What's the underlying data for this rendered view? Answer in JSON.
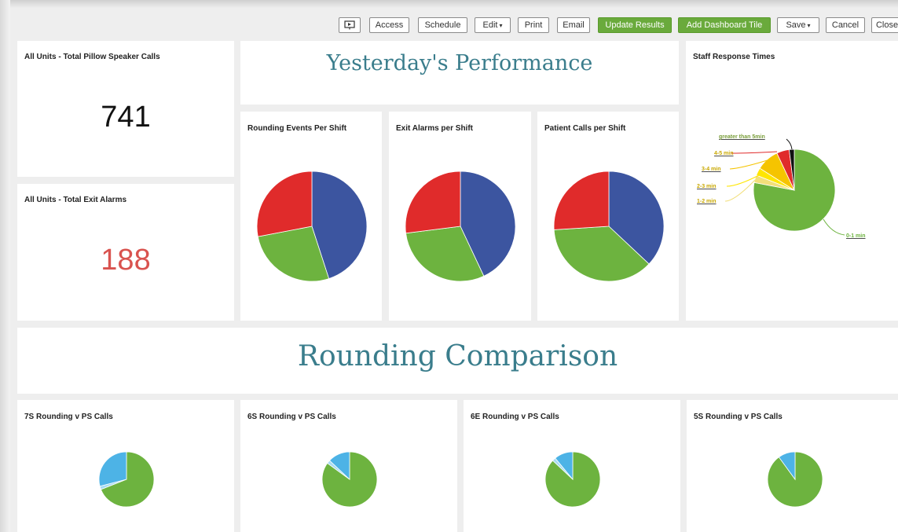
{
  "toolbar": {
    "present_icon": "present-icon",
    "access": "Access",
    "schedule": "Schedule",
    "edit": "Edit",
    "print": "Print",
    "email": "Email",
    "update_results": "Update Results",
    "add_tile": "Add Dashboard Tile",
    "save": "Save",
    "cancel": "Cancel",
    "close": "Close",
    "caret": "▾"
  },
  "colors": {
    "accent_green": "#6aaa3c",
    "heading_teal": "#3a7d8c",
    "pie_blue": "#3c55a0",
    "pie_green": "#6db33f",
    "pie_red": "#e02b2b",
    "pie_light_blue": "#4db3e6",
    "pie_yellow": "#f5c400",
    "big_red": "#d9534f"
  },
  "kpis": {
    "pillow_title": "All Units - Total Pillow Speaker Calls",
    "pillow_value": "741",
    "exit_title": "All Units - Total Exit Alarms",
    "exit_value": "188"
  },
  "headings": {
    "yesterday": "Yesterday's Performance",
    "rounding": "Rounding Comparison"
  },
  "shift_charts": {
    "rounding_title": "Rounding Events Per Shift",
    "exit_title": "Exit Alarms per Shift",
    "patient_title": "Patient Calls per Shift"
  },
  "staff": {
    "title": "Staff Response Times",
    "labels": [
      "0-1 min",
      "1-2 min",
      "2-3 min",
      "3-4 min",
      "4-5 min",
      "greater than 5min"
    ]
  },
  "units": {
    "u7s": "7S Rounding v PS Calls",
    "u6s": "6S Rounding v PS Calls",
    "u6e": "6E Rounding v PS Calls",
    "u5s": "5S Rounding v PS Calls"
  },
  "chart_data": [
    {
      "type": "pie",
      "values": [
        45,
        27,
        28
      ],
      "colors": [
        "#3c55a0",
        "#6db33f",
        "#e02b2b"
      ]
    },
    {
      "type": "pie",
      "values": [
        43,
        30,
        27
      ],
      "colors": [
        "#3c55a0",
        "#6db33f",
        "#e02b2b"
      ]
    },
    {
      "type": "pie",
      "values": [
        37,
        37,
        26
      ],
      "colors": [
        "#3c55a0",
        "#6db33f",
        "#e02b2b"
      ]
    },
    {
      "type": "pie",
      "categories": [
        "0-1 min",
        "1-2 min",
        "2-3 min",
        "3-4 min",
        "4-5 min",
        "greater than 5min"
      ],
      "values": [
        78,
        3,
        3,
        9,
        5,
        2
      ],
      "colors": [
        "#6db33f",
        "#f2df7a",
        "#ffe600",
        "#f5c400",
        "#e02b2b",
        "#111111"
      ]
    },
    {
      "type": "pie",
      "values": [
        69,
        2,
        29
      ],
      "colors": [
        "#6db33f",
        "#a9dcf2",
        "#4db3e6"
      ]
    },
    {
      "type": "pie",
      "values": [
        85,
        2,
        13
      ],
      "colors": [
        "#6db33f",
        "#a9dcf2",
        "#4db3e6"
      ]
    },
    {
      "type": "pie",
      "values": [
        87,
        2,
        11
      ],
      "colors": [
        "#6db33f",
        "#a9dcf2",
        "#4db3e6"
      ]
    },
    {
      "type": "pie",
      "values": [
        90,
        10
      ],
      "colors": [
        "#6db33f",
        "#4db3e6"
      ]
    }
  ]
}
